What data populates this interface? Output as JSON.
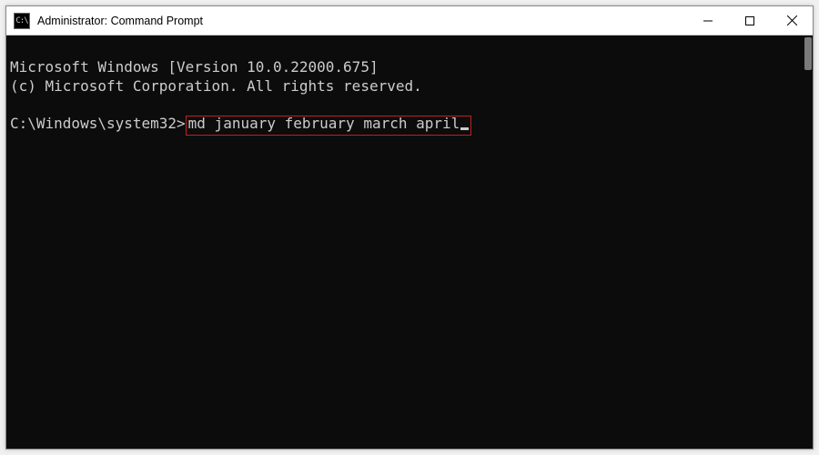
{
  "window": {
    "title": "Administrator: Command Prompt",
    "icon_text": "C:\\"
  },
  "terminal": {
    "line1": "Microsoft Windows [Version 10.0.22000.675]",
    "line2": "(c) Microsoft Corporation. All rights reserved.",
    "blank": "",
    "prompt": "C:\\Windows\\system32>",
    "command": "md january february march april"
  },
  "annotation": {
    "highlight_color": "#c02020"
  }
}
